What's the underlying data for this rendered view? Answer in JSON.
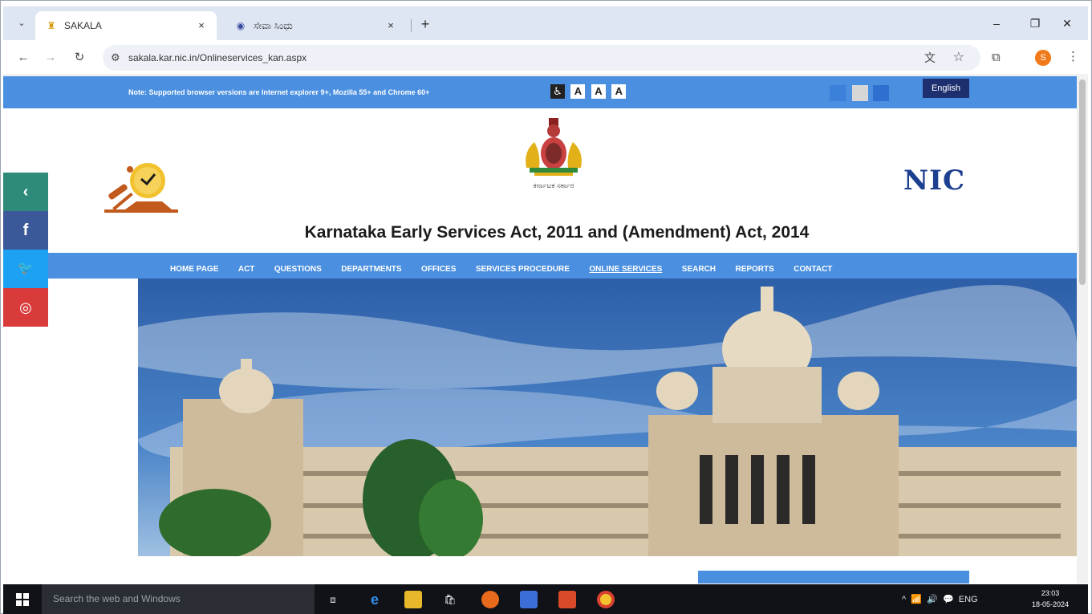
{
  "browser": {
    "tabs": [
      {
        "label": "SAKALA",
        "favicon": "sakala-emblem-icon",
        "active": true
      },
      {
        "label": "ಸೇವಾ ಸಿಂಧು",
        "favicon": "seva-sindhu-icon",
        "active": false
      }
    ],
    "close_glyph": "×",
    "new_tab_glyph": "+",
    "url": "sakala.kar.nic.in/Onlineservices_kan.aspx",
    "profile_initial": "S"
  },
  "page": {
    "note": "Note: Supported browser versions are Internet explorer 9+, Mozilla 55+ and Chrome 60+",
    "access_buttons": [
      "A",
      "A",
      "A"
    ],
    "language_button": "English",
    "emblem_caption": "ಕರ್ನಾಟಕ ಸರ್ಕಾರ",
    "nic_logo": "NIC",
    "title": "Karnataka Early Services Act, 2011 and (Amendment) Act, 2014",
    "nav": [
      {
        "label": "HOME PAGE"
      },
      {
        "label": "ACT"
      },
      {
        "label": "QUESTIONS"
      },
      {
        "label": "DEPARTMENTS"
      },
      {
        "label": "OFFICES"
      },
      {
        "label": "SERVICES PROCEDURE"
      },
      {
        "label": "ONLINE SERVICES"
      },
      {
        "label": "SEARCH"
      },
      {
        "label": "REPORTS"
      },
      {
        "label": "CONTACT"
      }
    ],
    "social": [
      {
        "name": "back",
        "glyph": "‹",
        "color": "#2e8b7a"
      },
      {
        "name": "facebook",
        "glyph": "f",
        "color": "#3b5998"
      },
      {
        "name": "twitter",
        "glyph": "🐦",
        "color": "#1da1f2"
      },
      {
        "name": "instagram",
        "glyph": "◎",
        "color": "#d93a3a"
      }
    ],
    "colors": {
      "primary_blue": "#4a8fe0",
      "language_button": "#1d2f6e",
      "nic_blue": "#1c3f8f"
    }
  },
  "taskbar": {
    "search_placeholder": "Search the web and Windows",
    "tray_lang": "ENG",
    "time": "23:03",
    "date": "18-05-2024"
  }
}
